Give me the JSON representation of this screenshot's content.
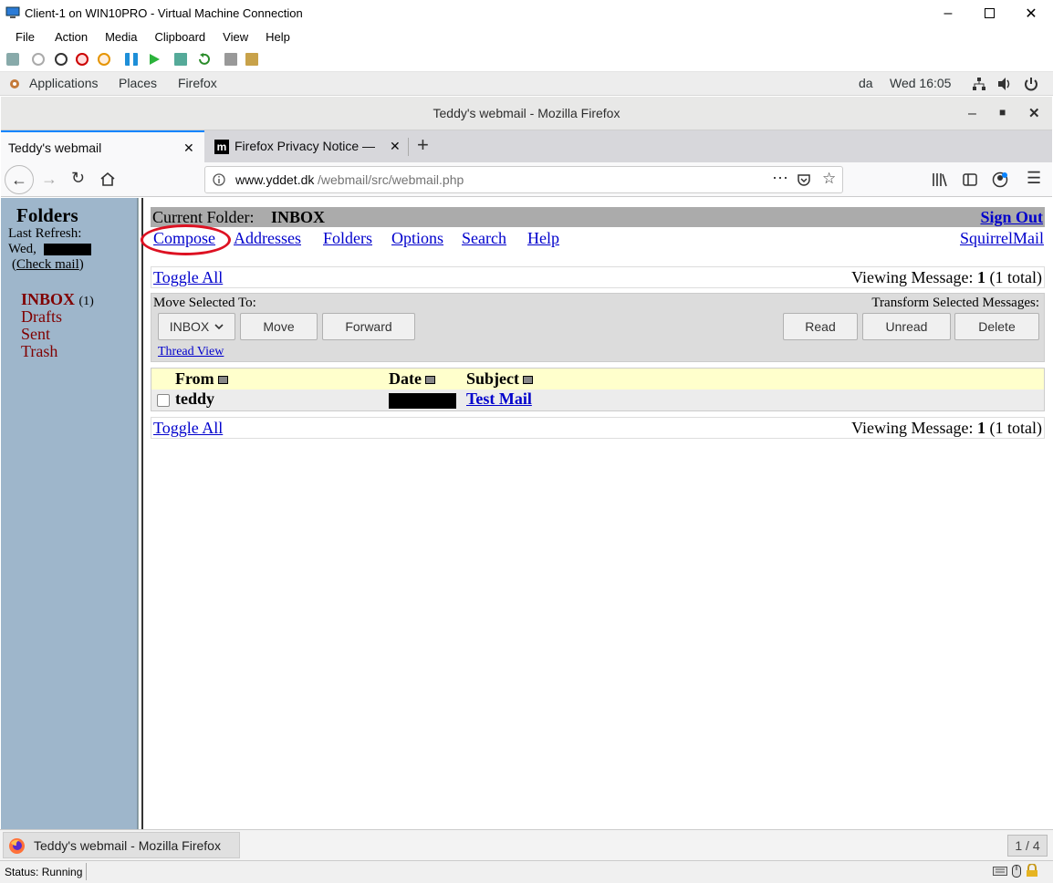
{
  "vm": {
    "title": "Client-1 on WIN10PRO - Virtual Machine Connection",
    "menu": [
      "File",
      "Action",
      "Media",
      "Clipboard",
      "View",
      "Help"
    ],
    "status": "Status: Running"
  },
  "gnome": {
    "applications": "Applications",
    "places": "Places",
    "firefox": "Firefox",
    "lang": "da",
    "clock": "Wed 16:05"
  },
  "firefox": {
    "window_title": "Teddy's webmail - Mozilla Firefox",
    "tabs": [
      {
        "label": "Teddy's webmail"
      },
      {
        "label": "Firefox Privacy Notice —"
      }
    ],
    "url_domain": "www.yddet.dk",
    "url_path": "/webmail/src/webmail.php"
  },
  "sidebar": {
    "title": "Folders",
    "last_refresh": "Last Refresh:",
    "refresh_day": "Wed,",
    "check_mail": "Check mail",
    "inbox": "INBOX",
    "inbox_count": "(1)",
    "folders": [
      "Drafts",
      "Sent",
      "Trash"
    ]
  },
  "main": {
    "current_folder_label": "Current Folder:",
    "current_folder": "INBOX",
    "sign_out": "Sign Out",
    "nav": [
      "Compose",
      "Addresses",
      "Folders",
      "Options",
      "Search",
      "Help"
    ],
    "squirrelmail": "SquirrelMail",
    "toggle_all": "Toggle All",
    "viewing_prefix": "Viewing Message:",
    "viewing_num": "1",
    "viewing_total": "(1 total)",
    "move_selected": "Move Selected To:",
    "transform_selected": "Transform Selected Messages:",
    "folder_select": "INBOX",
    "move": "Move",
    "forward": "Forward",
    "read": "Read",
    "unread": "Unread",
    "delete": "Delete",
    "thread_view": "Thread View",
    "headers": {
      "from": "From",
      "date": "Date",
      "subject": "Subject"
    },
    "messages": [
      {
        "from": "teddy",
        "subject": "Test Mail"
      }
    ]
  },
  "taskbar": {
    "window": "Teddy's webmail - Mozilla Firefox",
    "workspace": "1 / 4"
  },
  "colors": {
    "sidebar_bg": "#9eb6cb",
    "folder_link": "#800000",
    "header_bar": "#ababab",
    "table_header": "#ffffcc",
    "highlight": "#dd1122"
  }
}
